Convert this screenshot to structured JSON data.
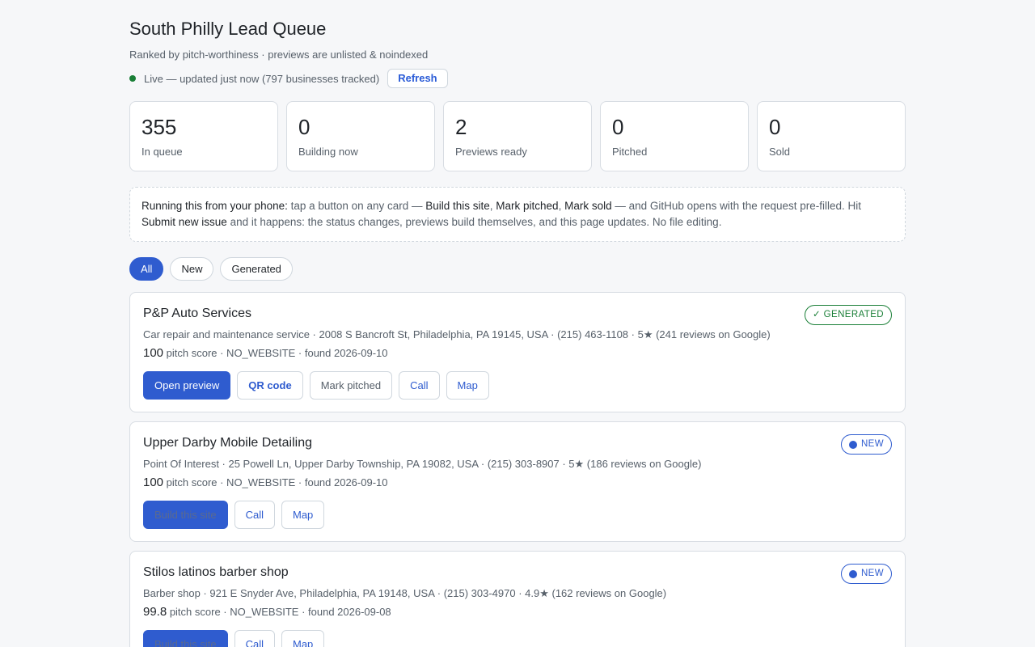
{
  "header": {
    "title": "South Philly Lead Queue",
    "subtitle": "Ranked by pitch-worthiness · previews are unlisted & noindexed",
    "live_text": "Live — updated just now (797 businesses tracked)",
    "refresh_label": "Refresh"
  },
  "stats": [
    {
      "value": "355",
      "label": "In queue"
    },
    {
      "value": "0",
      "label": "Building now"
    },
    {
      "value": "2",
      "label": "Previews ready"
    },
    {
      "value": "0",
      "label": "Pitched"
    },
    {
      "value": "0",
      "label": "Sold"
    }
  ],
  "note": {
    "lead": "Running this from your phone:",
    "t1": " tap a button on any card — ",
    "build": "Build this site",
    "sep1": ", ",
    "pitched": "Mark pitched",
    "sep2": ", ",
    "sold": "Mark sold",
    "t2": " — and GitHub opens with the request pre-filled. Hit ",
    "submit": "Submit new issue",
    "t3": " and it happens: the status changes, previews build themselves, and this page updates. No file editing."
  },
  "filters": [
    "All",
    "New",
    "Generated"
  ],
  "cards": [
    {
      "name": "P&P Auto Services",
      "meta": "Car repair and maintenance service · 2008 S Bancroft St, Philadelphia, PA 19145, USA · (215) 463-1108 · 5★ (241 reviews on Google)",
      "score": "100",
      "score_rest": " pitch score · NO_WEBSITE · found 2026-09-10",
      "badge": "✓ GENERATED",
      "actions": [
        "Open preview",
        "QR code",
        "Mark pitched",
        "Call",
        "Map"
      ]
    },
    {
      "name": "Upper Darby Mobile Detailing",
      "meta": "Point Of Interest · 25 Powell Ln, Upper Darby Township, PA 19082, USA · (215) 303-8907 · 5★ (186 reviews on Google)",
      "score": "100",
      "score_rest": " pitch score · NO_WEBSITE · found 2026-09-10",
      "badge": "NEW",
      "actions": [
        "Build this site",
        "Call",
        "Map"
      ]
    },
    {
      "name": "Stilos latinos barber shop",
      "meta": "Barber shop · 921 E Snyder Ave, Philadelphia, PA 19148, USA · (215) 303-4970 · 4.9★ (162 reviews on Google)",
      "score": "99.8",
      "score_rest": " pitch score · NO_WEBSITE · found 2026-09-08",
      "badge": "NEW",
      "actions": [
        "Build this site",
        "Call",
        "Map"
      ]
    }
  ],
  "colors": {
    "accent": "#2f5ccf",
    "live": "#1a7f37",
    "generated": "#1a7f37"
  }
}
